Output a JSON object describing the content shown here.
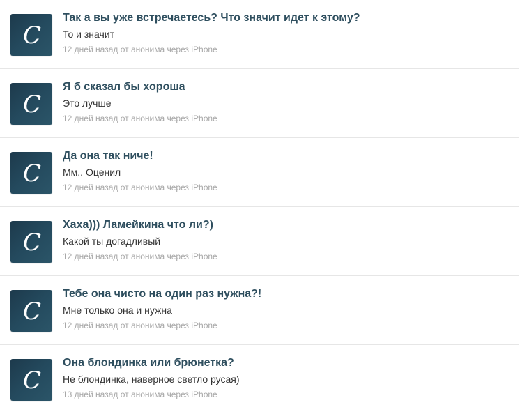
{
  "feed": {
    "items": [
      {
        "avatar_letter": "C",
        "question": "Так а вы уже встречаетесь? Что значит идет к этому?",
        "answer": "То и значит",
        "meta": "12 дней назад от анонима через iPhone"
      },
      {
        "avatar_letter": "C",
        "question": "Я б сказал бы хороша",
        "answer": "Это лучше",
        "meta": "12 дней назад от анонима через iPhone"
      },
      {
        "avatar_letter": "C",
        "question": "Да она так ниче!",
        "answer": "Мм.. Оценил",
        "meta": "12 дней назад от анонима через iPhone"
      },
      {
        "avatar_letter": "C",
        "question": "Хаха))) Ламейкина что ли?)",
        "answer": "Какой ты догадливый",
        "meta": "12 дней назад от анонима через iPhone"
      },
      {
        "avatar_letter": "C",
        "question": "Тебе она чисто на один раз нужна?!",
        "answer": "Мне только она и нужна",
        "meta": "12 дней назад от анонима через iPhone"
      },
      {
        "avatar_letter": "C",
        "question": "Она блондинка или брюнетка?",
        "answer": "Не блондинка, наверное светло русая)",
        "meta": "13 дней назад от анонима через iPhone"
      }
    ]
  }
}
